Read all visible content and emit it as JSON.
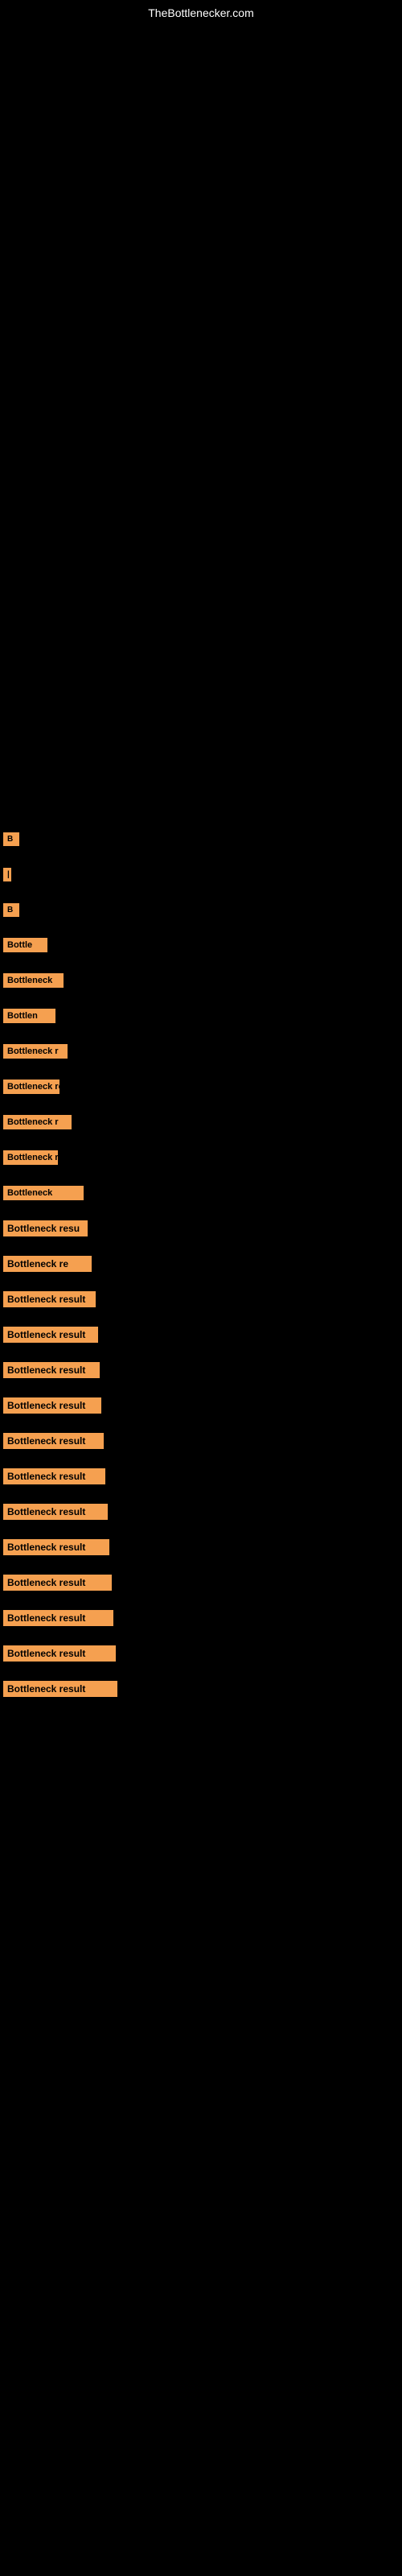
{
  "site": {
    "title": "TheBottlenecker.com"
  },
  "items": [
    {
      "id": 0,
      "label": "B"
    },
    {
      "id": 1,
      "label": "|"
    },
    {
      "id": 2,
      "label": "B"
    },
    {
      "id": 3,
      "label": "Bottle"
    },
    {
      "id": 4,
      "label": "Bottleneck"
    },
    {
      "id": 5,
      "label": "Bottlen"
    },
    {
      "id": 6,
      "label": "Bottleneck r"
    },
    {
      "id": 7,
      "label": "Bottleneck re"
    },
    {
      "id": 8,
      "label": "Bottleneck r"
    },
    {
      "id": 9,
      "label": "Bottleneck re"
    },
    {
      "id": 10,
      "label": "Bottleneck"
    },
    {
      "id": 11,
      "label": "Bottleneck resu"
    },
    {
      "id": 12,
      "label": "Bottleneck re"
    },
    {
      "id": 13,
      "label": "Bottleneck result"
    },
    {
      "id": 14,
      "label": "Bottleneck result"
    },
    {
      "id": 15,
      "label": "Bottleneck result"
    },
    {
      "id": 16,
      "label": "Bottleneck result"
    },
    {
      "id": 17,
      "label": "Bottleneck result"
    },
    {
      "id": 18,
      "label": "Bottleneck result"
    },
    {
      "id": 19,
      "label": "Bottleneck result"
    },
    {
      "id": 20,
      "label": "Bottleneck result"
    },
    {
      "id": 21,
      "label": "Bottleneck result"
    },
    {
      "id": 22,
      "label": "Bottleneck result"
    },
    {
      "id": 23,
      "label": "Bottleneck result"
    },
    {
      "id": 24,
      "label": "Bottleneck result"
    }
  ]
}
